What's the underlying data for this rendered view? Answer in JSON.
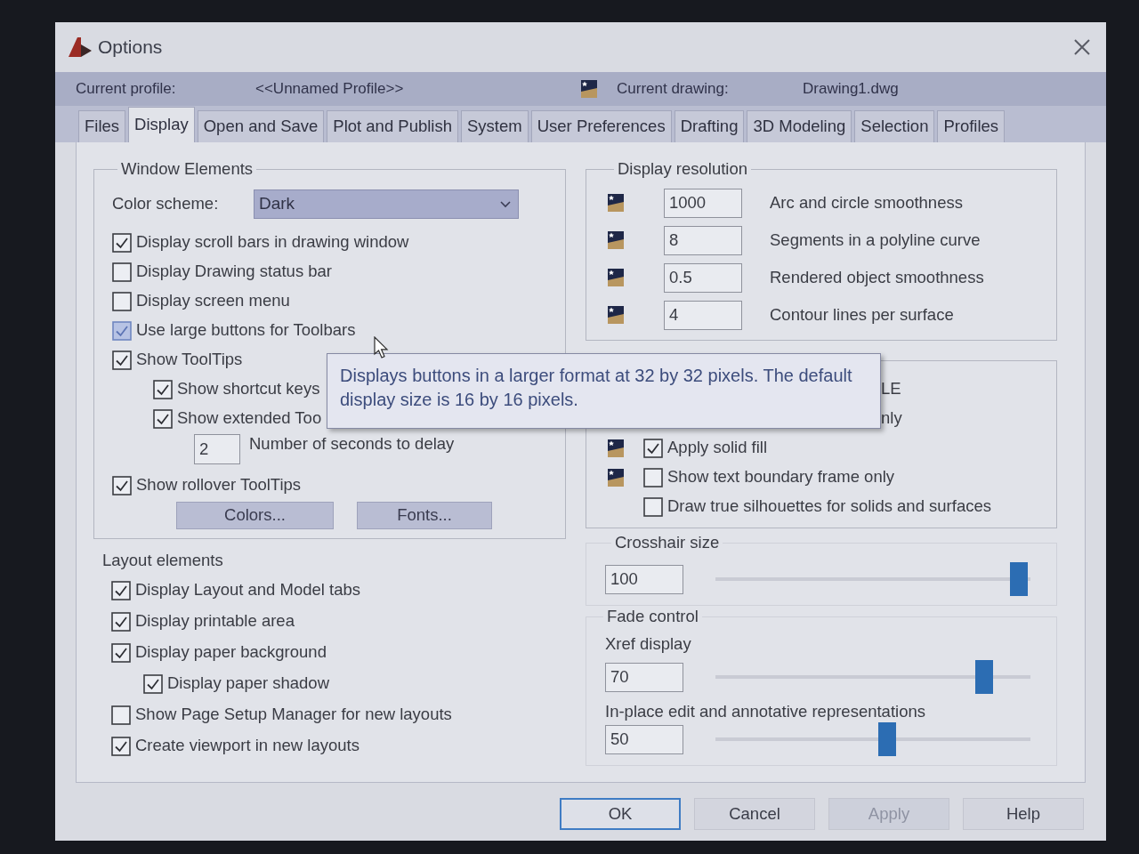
{
  "window": {
    "title": "Options"
  },
  "profile_bar": {
    "profile_label": "Current profile:",
    "profile": "<<Unnamed Profile>>",
    "drawing_label": "Current drawing:",
    "drawing": "Drawing1.dwg"
  },
  "tabs": [
    {
      "label": "Files",
      "selected": false
    },
    {
      "label": "Display",
      "selected": true
    },
    {
      "label": "Open and Save",
      "selected": false
    },
    {
      "label": "Plot and Publish",
      "selected": false
    },
    {
      "label": "System",
      "selected": false
    },
    {
      "label": "User Preferences",
      "selected": false
    },
    {
      "label": "Drafting",
      "selected": false
    },
    {
      "label": "3D Modeling",
      "selected": false
    },
    {
      "label": "Selection",
      "selected": false
    },
    {
      "label": "Profiles",
      "selected": false
    }
  ],
  "window_elements": {
    "title": "Window Elements",
    "color_scheme": {
      "label": "Color scheme:",
      "value": "Dark"
    },
    "options": [
      {
        "kind": "checkbox",
        "label": "Display scroll bars in drawing window",
        "checked": true,
        "hovered": false
      },
      {
        "kind": "checkbox",
        "label": "Display Drawing status bar",
        "checked": false,
        "hovered": false
      },
      {
        "kind": "checkbox",
        "label": "Display screen menu",
        "checked": false,
        "hovered": false
      },
      {
        "kind": "checkbox",
        "label": "Use large buttons for Toolbars",
        "checked": true,
        "hovered": true
      },
      {
        "kind": "checkbox",
        "label": "Show ToolTips",
        "checked": true,
        "hovered": false,
        "children": [
          {
            "kind": "checkbox",
            "label": "Show shortcut keys",
            "checked": true,
            "hovered": false
          },
          {
            "kind": "checkbox",
            "label": "Show extended Too",
            "checked": true,
            "hovered": false,
            "children": [
              {
                "kind": "number",
                "value": "2",
                "label": "Number of seconds to delay"
              }
            ]
          }
        ]
      },
      {
        "kind": "checkbox",
        "label": "Show rollover ToolTips",
        "checked": true,
        "hovered": false
      }
    ],
    "buttons": [
      "Colors...",
      "Fonts..."
    ]
  },
  "layout_elements": {
    "title": "Layout elements",
    "options": [
      {
        "kind": "checkbox",
        "label": "Display Layout and Model tabs",
        "checked": true
      },
      {
        "kind": "checkbox",
        "label": "Display printable area",
        "checked": true
      },
      {
        "kind": "checkbox",
        "label": "Display paper background",
        "checked": true,
        "children": [
          {
            "kind": "checkbox",
            "label": "Display paper shadow",
            "checked": true
          }
        ]
      },
      {
        "kind": "checkbox",
        "label": "Show Page Setup Manager for new layouts",
        "checked": false
      },
      {
        "kind": "checkbox",
        "label": "Create viewport in new layouts",
        "checked": true
      }
    ]
  },
  "display_resolution": {
    "title": "Display resolution",
    "rows": [
      {
        "value": "1000",
        "label": "Arc and circle smoothness",
        "stored_in_drawing": true
      },
      {
        "value": "8",
        "label": "Segments in a polyline curve",
        "stored_in_drawing": true
      },
      {
        "value": "0.5",
        "label": "Rendered object smoothness",
        "stored_in_drawing": true
      },
      {
        "value": "4",
        "label": "Contour lines per surface",
        "stored_in_drawing": true
      }
    ]
  },
  "display_performance": {
    "rows": [
      {
        "kind": "covered",
        "label": "LE"
      },
      {
        "kind": "covered",
        "label": "nly"
      },
      {
        "kind": "checkbox",
        "label": "Apply solid fill",
        "checked": true,
        "stored_in_drawing": true
      },
      {
        "kind": "checkbox",
        "label": "Show text boundary frame only",
        "checked": false,
        "stored_in_drawing": true
      },
      {
        "kind": "checkbox",
        "label": "Draw true silhouettes for solids and surfaces",
        "checked": false,
        "stored_in_drawing": false
      }
    ]
  },
  "crosshair": {
    "label": "Crosshair size",
    "value": "100",
    "level": 1.0
  },
  "fade_control": {
    "title": "Fade control",
    "sliders": [
      {
        "label": "Xref display",
        "value": "70",
        "level": 0.88
      },
      {
        "label": "In-place edit and annotative representations",
        "value": "50",
        "level": 0.55
      }
    ]
  },
  "buttons": [
    {
      "label": "OK",
      "default": true,
      "disabled": false
    },
    {
      "label": "Cancel",
      "default": false,
      "disabled": false
    },
    {
      "label": "Apply",
      "default": false,
      "disabled": true
    },
    {
      "label": "Help",
      "default": false,
      "disabled": false
    }
  ],
  "tooltip": {
    "text": "Displays buttons in a larger format at 32 by 32 pixels. The default display size is 16 by 16 pixels."
  }
}
